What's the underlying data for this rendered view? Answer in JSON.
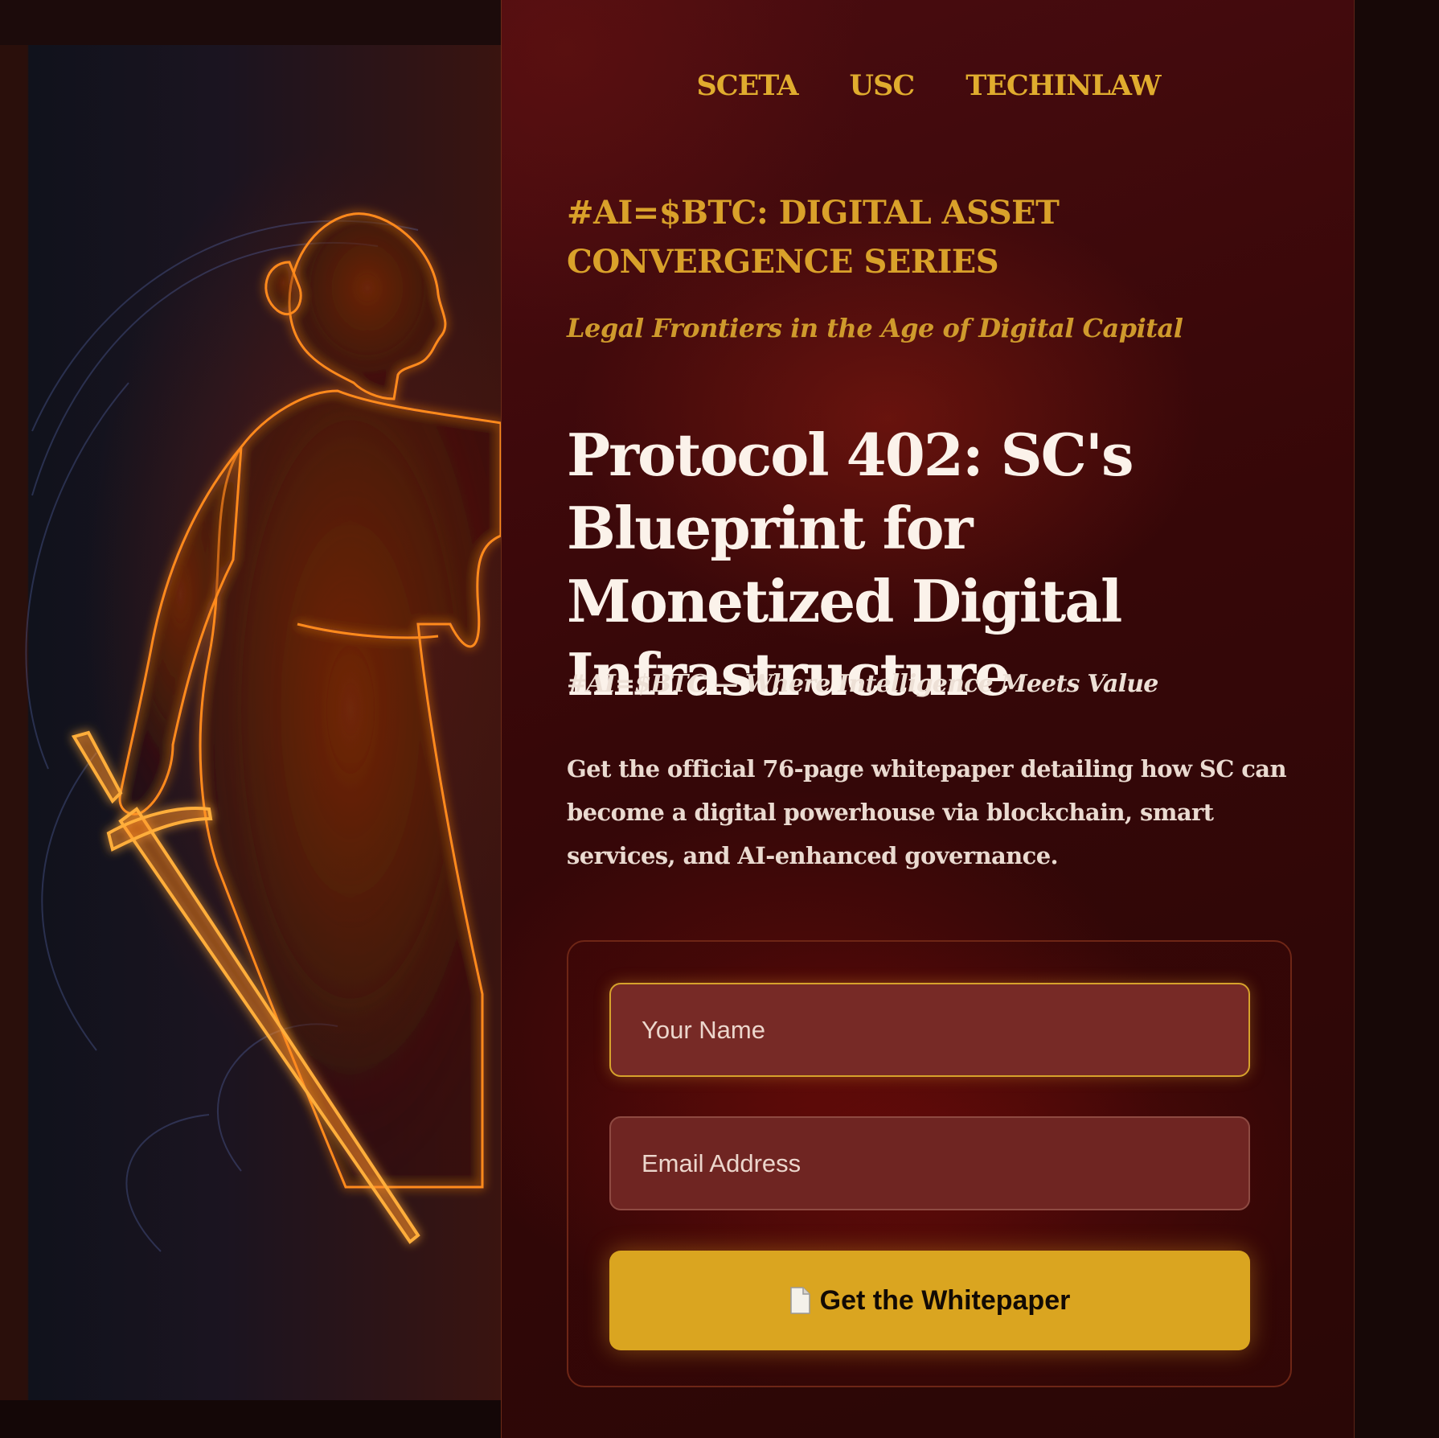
{
  "nav": {
    "links": [
      "SCETA",
      "USC",
      "TECHINLAW"
    ]
  },
  "hero": {
    "series": "#AI=$BTC: DIGITAL ASSET CONVERGENCE SERIES",
    "tagline": "Legal Frontiers in the Age of Digital Capital",
    "title": "Protocol 402: SC's Blueprint for Monetized Digital Infrastructure",
    "subline": "#AI=$BTC — Where Intelligence Meets Value",
    "description": "Get the official 76-page whitepaper detailing how SC can become a digital powerhouse via blockchain, smart services, and AI-enhanced governance."
  },
  "form": {
    "name_placeholder": "Your Name",
    "email_placeholder": "Email Address",
    "submit_label": "Get the Whitepaper",
    "submit_icon": "document-icon"
  },
  "colors": {
    "accent_gold": "#daa520",
    "heading_gold": "#e0ac2e",
    "panel_maroon": "#3a0708"
  }
}
